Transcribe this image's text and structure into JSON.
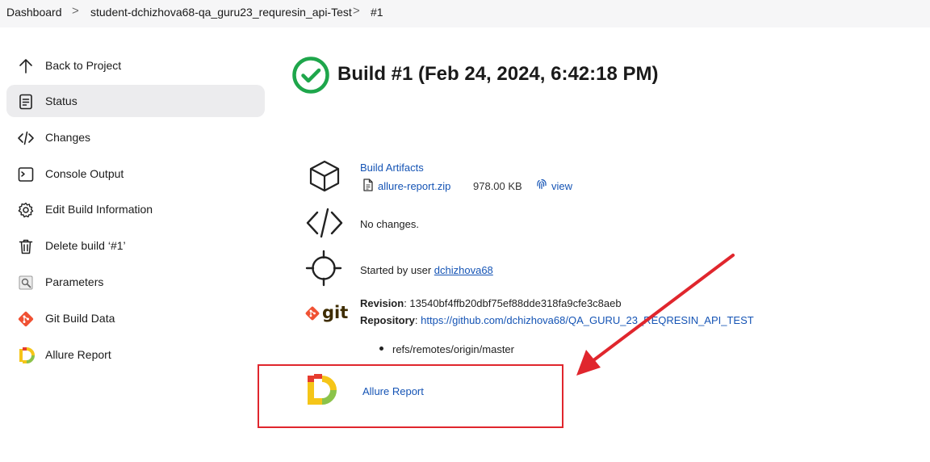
{
  "breadcrumb": {
    "items": [
      "Dashboard",
      "student-dchizhova68-qa_guru23_requresin_api-Test",
      "#1"
    ],
    "separator": ">"
  },
  "sidebar": {
    "items": [
      {
        "label": "Back to Project",
        "icon": "arrow-up-icon"
      },
      {
        "label": "Status",
        "icon": "document-icon",
        "active": true
      },
      {
        "label": "Changes",
        "icon": "code-icon"
      },
      {
        "label": "Console Output",
        "icon": "terminal-icon"
      },
      {
        "label": "Edit Build Information",
        "icon": "gear-icon"
      },
      {
        "label": "Delete build ‘#1’",
        "icon": "trash-icon"
      },
      {
        "label": "Parameters",
        "icon": "parameters-icon"
      },
      {
        "label": "Git Build Data",
        "icon": "git-icon"
      },
      {
        "label": "Allure Report",
        "icon": "allure-icon"
      }
    ]
  },
  "main": {
    "title": "Build #1 (Feb 24, 2024, 6:42:18 PM)",
    "status_color": "#1ea64b",
    "artifacts": {
      "heading": "Build Artifacts",
      "file": "allure-report.zip",
      "size": "978.00 KB",
      "view": "view"
    },
    "changes": "No changes.",
    "started_by_prefix": "Started by user ",
    "started_by_user": "dchizhova68",
    "revision_label": "Revision",
    "revision_value": ": 13540bf4ffb20dbf75ef88dde318fa9cfe3c8aeb",
    "repository_label": "Repository",
    "repository_sep": ": ",
    "repository_value": "https://github.com/dchizhova68/QA_GURU_23_REQRESIN_API_TEST",
    "branch": "refs/remotes/origin/master",
    "allure_link": "Allure Report",
    "git_logo_text": "git"
  },
  "colors": {
    "link": "#1554b5",
    "highlight": "#e0262d",
    "git": "#f05133"
  }
}
